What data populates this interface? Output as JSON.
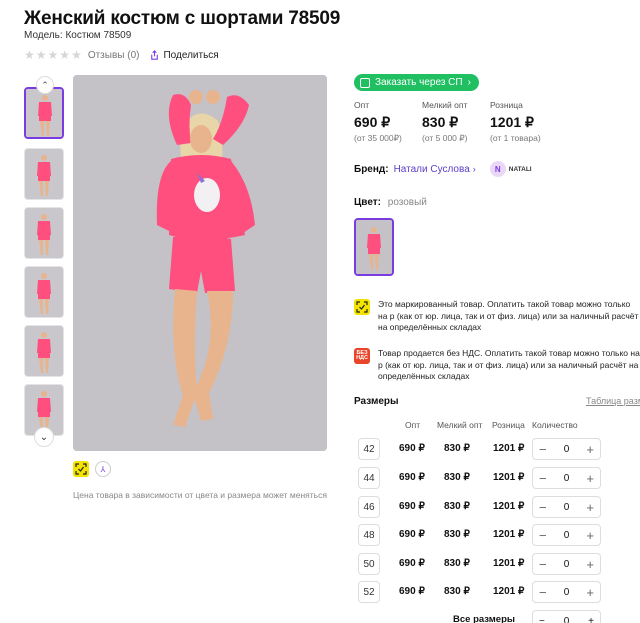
{
  "product": {
    "title": "Женский костюм с шортами 78509",
    "model": "Модель: Костюм 78509",
    "reviews": "Отзывы (0)",
    "share": "Поделиться",
    "price_note": "Цена товара в зависимости от цвета и размера может меняться"
  },
  "order_button": {
    "label": "Заказать через СП",
    "color": "#1fbf62"
  },
  "prices": [
    {
      "label": "Опт",
      "value": "690 ₽",
      "sub": "(от 35 000₽)"
    },
    {
      "label": "Мелкий опт",
      "value": "830 ₽",
      "sub": "(от 5 000 ₽)"
    },
    {
      "label": "Розница",
      "value": "1201 ₽",
      "sub": "(от 1 товара)"
    }
  ],
  "brand": {
    "label": "Бренд:",
    "name": "Натали Суслова",
    "logo_text": "NATALI",
    "logo_letter": "N"
  },
  "color": {
    "label": "Цвет:",
    "value": "розовый"
  },
  "notices": [
    {
      "icon": "marking-icon",
      "text": "Это маркированный товар. Оплатить такой товар можно только на р (как от юр. лица, так и от физ. лица) или за наличный расчёт на определённых складах"
    },
    {
      "icon": "no-vat-icon",
      "icon_text": "БЕЗ НДС",
      "text": "Товар продается без НДС. Оплатить такой товар можно только на р (как от юр. лица, так и от физ. лица) или за наличный расчёт на определённых складах"
    }
  ],
  "sizes": {
    "title": "Размеры",
    "table_link": "Таблица разм",
    "headers": {
      "opt": "Опт",
      "small_opt": "Мелкий опт",
      "retail": "Розница",
      "qty": "Количество"
    },
    "rows": [
      {
        "size": "42",
        "opt": "690 ₽",
        "small_opt": "830 ₽",
        "retail": "1201 ₽",
        "qty": "0"
      },
      {
        "size": "44",
        "opt": "690 ₽",
        "small_opt": "830 ₽",
        "retail": "1201 ₽",
        "qty": "0"
      },
      {
        "size": "46",
        "opt": "690 ₽",
        "small_opt": "830 ₽",
        "retail": "1201 ₽",
        "qty": "0"
      },
      {
        "size": "48",
        "opt": "690 ₽",
        "small_opt": "830 ₽",
        "retail": "1201 ₽",
        "qty": "0"
      },
      {
        "size": "50",
        "opt": "690 ₽",
        "small_opt": "830 ₽",
        "retail": "1201 ₽",
        "qty": "0"
      },
      {
        "size": "52",
        "opt": "690 ₽",
        "small_opt": "830 ₽",
        "retail": "1201 ₽",
        "qty": "0"
      }
    ],
    "all_sizes_label": "Все размеры",
    "all_sizes_qty": "0"
  },
  "colors": {
    "accent": "#7a3ce0",
    "outfit": "#ff4f7e",
    "photo_bg": "#c4c2c6"
  }
}
